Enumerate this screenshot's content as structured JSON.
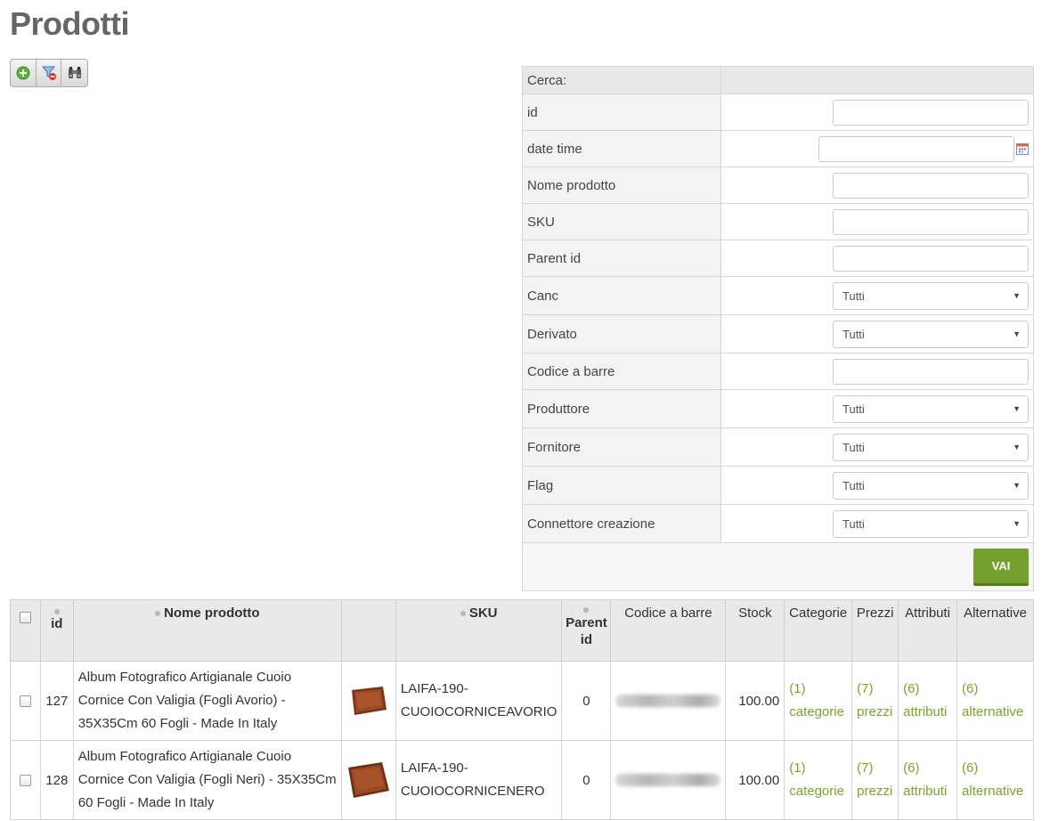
{
  "page": {
    "title": "Prodotti"
  },
  "toolbar": {
    "add_icon": "add-icon",
    "filter_reset_icon": "filter-reset-icon",
    "binoculars_icon": "binoculars-icon"
  },
  "search": {
    "header": "Cerca:",
    "fields": {
      "id": {
        "label": "id",
        "value": ""
      },
      "date_time": {
        "label": "date time",
        "value": ""
      },
      "nome_prodotto": {
        "label": "Nome prodotto",
        "value": ""
      },
      "sku": {
        "label": "SKU",
        "value": ""
      },
      "parent_id": {
        "label": "Parent id",
        "value": ""
      },
      "canc": {
        "label": "Canc",
        "selected": "Tutti"
      },
      "derivato": {
        "label": "Derivato",
        "selected": "Tutti"
      },
      "codice_barre": {
        "label": "Codice a barre",
        "value": ""
      },
      "produttore": {
        "label": "Produttore",
        "selected": "Tutti"
      },
      "fornitore": {
        "label": "Fornitore",
        "selected": "Tutti"
      },
      "flag": {
        "label": "Flag",
        "selected": "Tutti"
      },
      "connettore": {
        "label": "Connettore creazione",
        "selected": "Tutti"
      }
    },
    "submit_label": "VAI"
  },
  "table": {
    "headers": {
      "id": "id",
      "nome": "Nome prodotto",
      "sku": "SKU",
      "parent_line1": "Parent",
      "parent_line2": "id",
      "barcode": "Codice a barre",
      "stock": "Stock",
      "categorie": "Categorie",
      "prezzi": "Prezzi",
      "attributi": "Attributi",
      "alternative": "Alternative"
    },
    "rows": [
      {
        "id": "127",
        "nome": "Album Fotografico Artigianale Cuoio Cornice Con Valigia (Fogli Avorio) - 35X35Cm 60 Fogli - Made In Italy",
        "sku": "LAIFA-190-CUOIOCORNICEAVORIO",
        "parent_id": "0",
        "stock": "100.00",
        "categorie_count": "(1)",
        "categorie_label": "categorie",
        "prezzi_count": "(7)",
        "prezzi_label": "prezzi",
        "attributi_count": "(6)",
        "attributi_label": "attributi",
        "alternative_count": "(6)",
        "alternative_label": "alternative"
      },
      {
        "id": "128",
        "nome": "Album Fotografico Artigianale Cuoio Cornice Con Valigia (Fogli Neri) - 35X35Cm 60 Fogli - Made In Italy",
        "sku": "LAIFA-190-CUOIOCORNICENERO",
        "parent_id": "0",
        "stock": "100.00",
        "categorie_count": "(1)",
        "categorie_label": "categorie",
        "prezzi_count": "(7)",
        "prezzi_label": "prezzi",
        "attributi_count": "(6)",
        "attributi_label": "attributi",
        "alternative_count": "(6)",
        "alternative_label": "alternative"
      }
    ]
  },
  "colors": {
    "accent_green": "#74a12e",
    "link_green": "#7aa526",
    "title_gray": "#666666"
  }
}
